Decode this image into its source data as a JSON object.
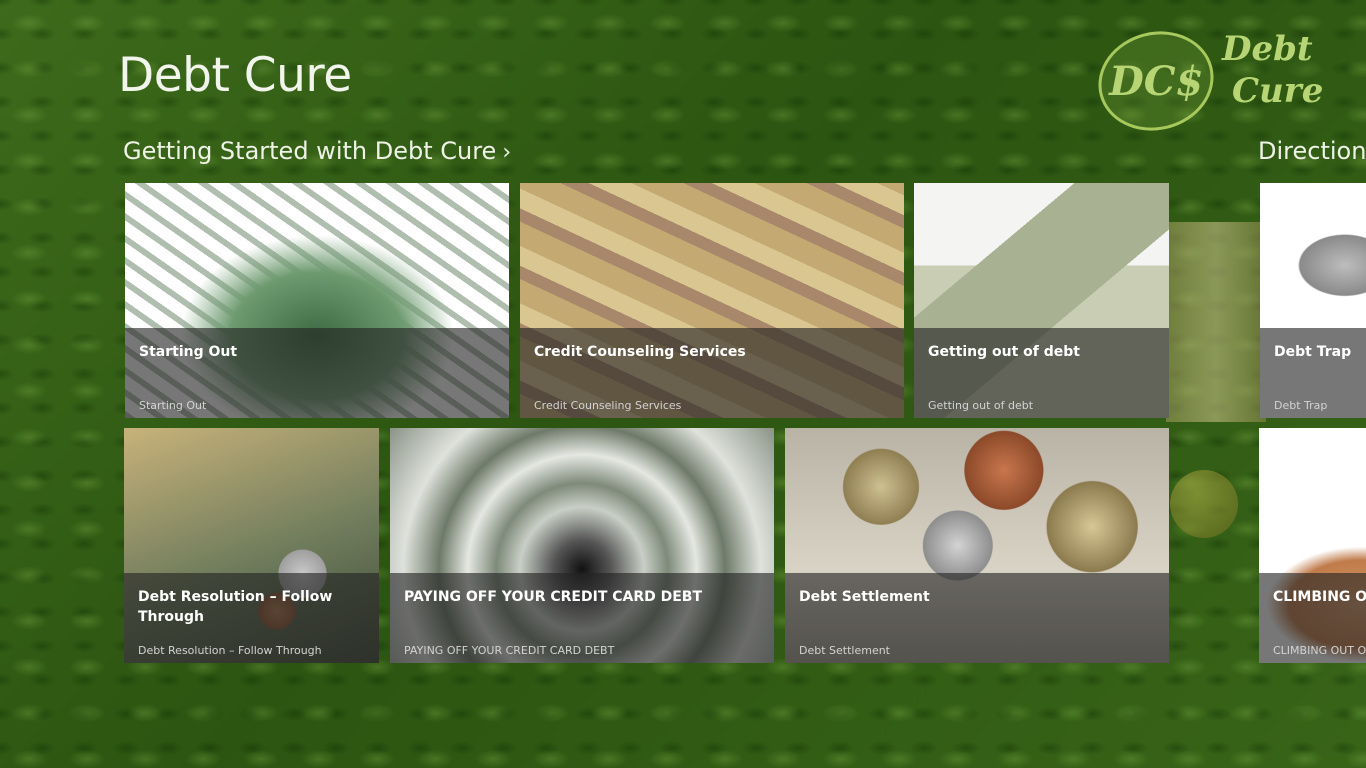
{
  "app": {
    "title": "Debt Cure"
  },
  "logo": {
    "monogram": "DC$",
    "line1": "Debt",
    "line2": "Cure"
  },
  "groups": [
    {
      "label": "Getting Started with Debt Cure",
      "chevron": "›"
    },
    {
      "label": "Directions"
    }
  ],
  "tiles": [
    {
      "title": "Starting Out",
      "subtitle": "Starting Out",
      "image": "money-pile"
    },
    {
      "title": "Credit Counseling Services",
      "subtitle": "Credit Counseling Services",
      "image": "rupee-notes"
    },
    {
      "title": "Getting out of debt",
      "subtitle": "Getting out of debt",
      "image": "dollar-house"
    },
    {
      "title": "Debt Trap",
      "subtitle": "Debt Trap",
      "image": "coin-edge"
    },
    {
      "title": "Debt Resolution – Follow Through",
      "subtitle": "Debt Resolution – Follow Through",
      "image": "coins-and-dollars"
    },
    {
      "title": "PAYING OFF YOUR CREDIT CARD DEBT",
      "subtitle": "PAYING OFF YOUR CREDIT CARD DEBT",
      "image": "money-tunnel"
    },
    {
      "title": "Debt Settlement",
      "subtitle": "Debt Settlement",
      "image": "pound-coins"
    },
    {
      "title": "CLIMBING OUT OF DEBT",
      "subtitle": "CLIMBING OUT OF DEBT",
      "image": "hand"
    }
  ],
  "colors": {
    "background": "#2f5a14",
    "overlay": "rgba(36,36,36,0.62)",
    "logo": "#b7d574"
  }
}
